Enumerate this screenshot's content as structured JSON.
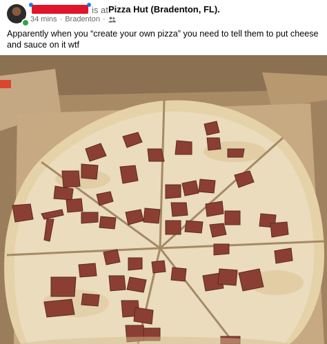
{
  "post": {
    "author_name_redacted": true,
    "is_at_label": "is at",
    "location": "Pizza Hut (Bradenton, FL).",
    "time": "34 mins",
    "place": "Bradenton",
    "audience_icon": "friends-icon",
    "text": "Apparently when you “create your own pizza” you need to tell them to put cheese and sauce on it wtf",
    "photo_icon": "pizza-photo"
  },
  "colors": {
    "redaction": "#e0152a",
    "online": "#31a24c",
    "secondary_text": "#65676b",
    "primary_text": "#050505"
  }
}
